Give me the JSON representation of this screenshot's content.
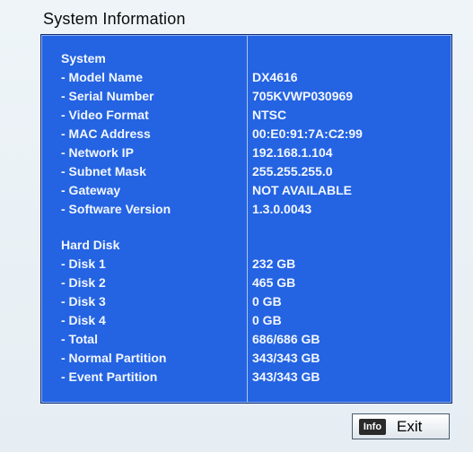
{
  "window": {
    "title": "System Information"
  },
  "system": {
    "header": "System",
    "items": [
      {
        "label": " - Model Name",
        "value": "DX4616"
      },
      {
        "label": " - Serial Number",
        "value": "705KVWP030969"
      },
      {
        "label": " - Video Format",
        "value": "NTSC"
      },
      {
        "label": " - MAC Address",
        "value": "00:E0:91:7A:C2:99"
      },
      {
        "label": " - Network IP",
        "value": "192.168.1.104"
      },
      {
        "label": " - Subnet Mask",
        "value": "255.255.255.0"
      },
      {
        "label": " - Gateway",
        "value": "NOT AVAILABLE"
      },
      {
        "label": " - Software Version",
        "value": "1.3.0.0043"
      }
    ]
  },
  "hard_disk": {
    "header": "Hard Disk",
    "items": [
      {
        "label": " - Disk 1",
        "value": "232 GB"
      },
      {
        "label": " - Disk 2",
        "value": "465 GB"
      },
      {
        "label": " - Disk 3",
        "value": "0 GB"
      },
      {
        "label": " - Disk 4",
        "value": "0 GB"
      },
      {
        "label": " - Total",
        "value": "686/686 GB"
      },
      {
        "label": " - Normal Partition",
        "value": "343/343 GB"
      },
      {
        "label": " - Event Partition",
        "value": "343/343 GB"
      }
    ]
  },
  "footer": {
    "key_badge": "Info",
    "exit_label": "Exit"
  },
  "colors": {
    "panel_background": "#2463e2",
    "window_background": "#eef4f8",
    "text_on_panel": "#f2f7ff"
  }
}
